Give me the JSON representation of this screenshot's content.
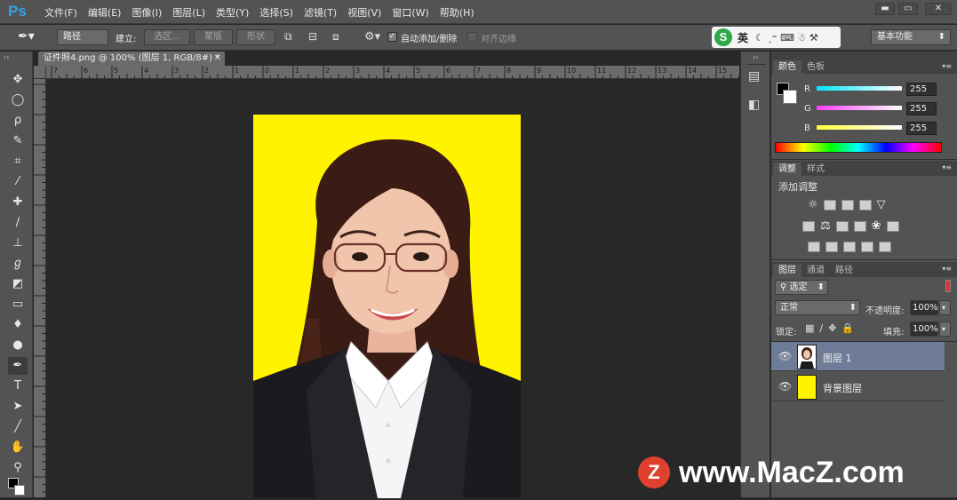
{
  "app": {
    "logo": "Ps"
  },
  "menu": [
    "文件(F)",
    "编辑(E)",
    "图像(I)",
    "图层(L)",
    "类型(Y)",
    "选择(S)",
    "滤镜(T)",
    "视图(V)",
    "窗口(W)",
    "帮助(H)"
  ],
  "window_controls": {
    "minimize": "▬",
    "maximize": "▭",
    "close": "✕"
  },
  "options": {
    "mode_select": "路径",
    "build_label": "建立:",
    "btn_selection": "选区...",
    "btn_mask": "蒙版",
    "btn_shape": "形状",
    "auto_add_delete": "自动添加/删除",
    "align_edges": "对齐边缘",
    "workspace": "基本功能",
    "ime_label": "英"
  },
  "document": {
    "tab_title": "证件照4.png @ 100% (图层 1, RGB/8#) *",
    "ruler_labels": [
      "7",
      "6",
      "5",
      "4",
      "3",
      "2",
      "1",
      "0",
      "1",
      "2",
      "3",
      "4",
      "5",
      "6",
      "7",
      "8",
      "9",
      "10",
      "11",
      "12",
      "13",
      "14",
      "15"
    ]
  },
  "color_panel": {
    "tabs": [
      "颜色",
      "色板"
    ],
    "channels": [
      {
        "label": "R",
        "value": "255",
        "color": "#00e5ff"
      },
      {
        "label": "G",
        "value": "255",
        "color": "#ff3dff"
      },
      {
        "label": "B",
        "value": "255",
        "color": "#ffff3a"
      }
    ]
  },
  "adjust_panel": {
    "tabs": [
      "调整",
      "样式"
    ],
    "title": "添加调整"
  },
  "layers_panel": {
    "tabs": [
      "图层",
      "通道",
      "路径"
    ],
    "filter": "选定",
    "blend_mode": "正常",
    "opacity_label": "不透明度:",
    "opacity": "100%",
    "lock_label": "锁定:",
    "fill_label": "填充:",
    "fill": "100%",
    "layers": [
      {
        "name": "图层 1",
        "selected": true
      },
      {
        "name": "背景图层",
        "selected": false
      }
    ]
  },
  "colors": {
    "accent": "#2fa3e6",
    "photo_bg": "#fff300",
    "selected_layer": "#6e7c97"
  },
  "watermark": {
    "logo": "Z",
    "text": "www.MacZ.com"
  }
}
